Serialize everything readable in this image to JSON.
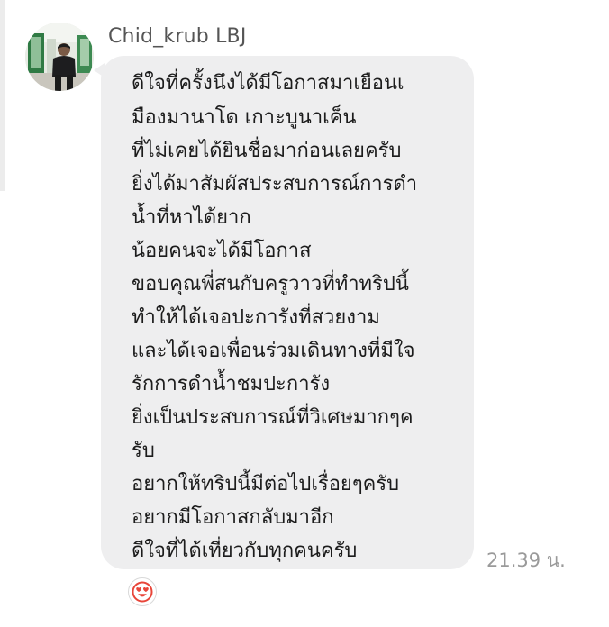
{
  "conversation": {
    "sender_name": "Chid_krub LBJ",
    "message_lines": [
      "ดีใจที่ครั้งนึงได้มีโอกาสมาเยือนเ",
      "มืองมานาโด เกาะบูนาเค็น",
      "ที่ไม่เคยได้ยินชื่อมาก่อนเลยครับ",
      "ยิ่งได้มาสัมผัสประสบการณ์การดำ",
      "น้ำที่หาได้ยาก",
      "น้อยคนจะได้มีโอกาส",
      "ขอบคุณพี่สนกับครูวาวที่ทำทริปนี้",
      "ทำให้ได้เจอปะการังที่สวยงาม",
      "และได้เจอเพื่อนร่วมเดินทางที่มีใจ",
      "รักการดำน้ำชมปะการัง",
      "ยิ่งเป็นประสบการณ์ที่วิเศษมากๆค",
      "รับ",
      "อยากให้ทริปนี้มีต่อไปเรื่อยๆครับ",
      "อยากมีโอกาสกลับมาอีก",
      "ดีใจที่ได้เที่ยวกับทุกคนครับ"
    ],
    "timestamp": "21.39 น.",
    "reaction_icon": "heart-eyes-emoji-icon",
    "colors": {
      "bubble": "#eeeeef",
      "reaction_face": "#e8463a"
    }
  }
}
